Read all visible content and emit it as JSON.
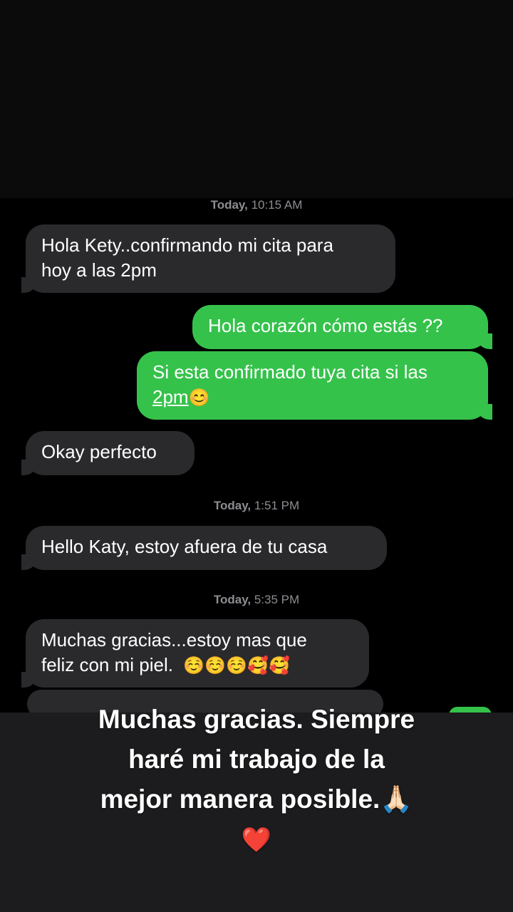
{
  "timestamps": [
    {
      "day": "Today,",
      "time": "10:15 AM"
    },
    {
      "day": "Today,",
      "time": "1:51 PM"
    },
    {
      "day": "Today,",
      "time": "5:35 PM"
    }
  ],
  "messages": {
    "m1": {
      "line1": "Hola Kety..confirmando mi cita para",
      "line2": "hoy a las 2pm"
    },
    "m2": {
      "text": "Hola corazón cómo estás ??"
    },
    "m3": {
      "line1": "Si esta confirmado tuya cita si las",
      "link": "2pm",
      "emoji": "😊"
    },
    "m4": {
      "text": "Okay perfecto"
    },
    "m5": {
      "text": "Hello Katy,  estoy afuera de tu casa"
    },
    "m6": {
      "line1": "Muchas  gracias...estoy mas que",
      "line2": "feliz con mi piel.",
      "emojis": "☺️☺️☺️🥰🥰"
    }
  },
  "caption": {
    "line1": "Muchas gracias. Siempre",
    "line2": "haré mi trabajo de la",
    "line3": "mejor manera posible.🙏🏻",
    "heart": "❤️"
  },
  "colors": {
    "incoming": "#2a2a2d",
    "outgoing": "#35c24b",
    "background": "#000000"
  }
}
